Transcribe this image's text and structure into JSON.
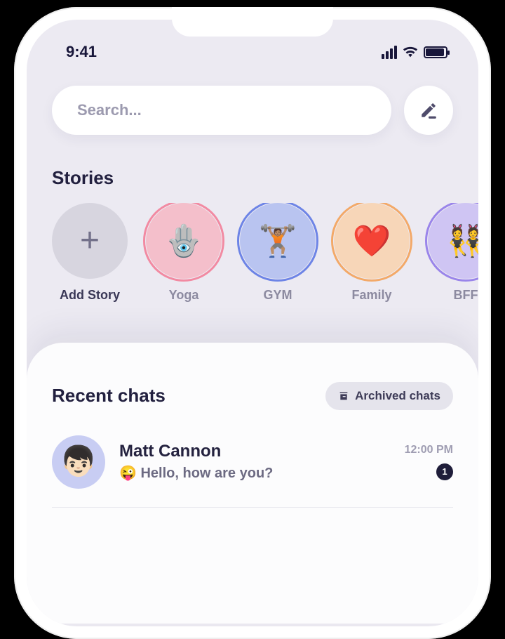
{
  "status": {
    "time": "9:41"
  },
  "search": {
    "placeholder": "Search..."
  },
  "stories": {
    "title": "Stories",
    "add_label": "Add Story",
    "items": [
      {
        "label": "Yoga",
        "emoji": "🪬",
        "bg": "#f4bfcb",
        "ring": "#f28aa2"
      },
      {
        "label": "GYM",
        "emoji": "🏋🏽",
        "bg": "#b9c4f0",
        "ring": "#6d84e6"
      },
      {
        "label": "Family",
        "emoji": "❤️",
        "bg": "#f7d6b8",
        "ring": "#f3a968"
      },
      {
        "label": "BFF",
        "emoji": "👯",
        "bg": "#cfc5f3",
        "ring": "#9a85ea"
      }
    ]
  },
  "chats": {
    "title": "Recent chats",
    "archived_label": "Archived chats",
    "items": [
      {
        "name": "Matt Cannon",
        "preview_emoji": "😜",
        "preview_text": "Hello, how are you?",
        "time": "12:00 PM",
        "unread": "1",
        "avatar_emoji": "👦🏻"
      }
    ]
  }
}
